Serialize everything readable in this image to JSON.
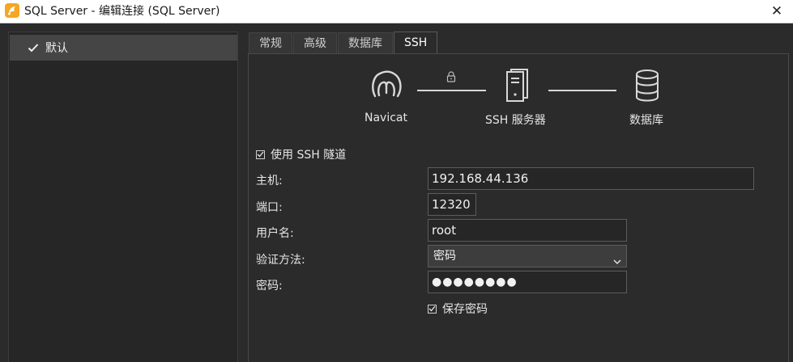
{
  "window": {
    "title": "SQL Server - 编辑连接 (SQL Server)",
    "close_symbol": "✕"
  },
  "sidebar": {
    "items": [
      {
        "label": "默认",
        "selected": true
      }
    ]
  },
  "tabs": [
    {
      "label": "常规",
      "active": false
    },
    {
      "label": "高级",
      "active": false
    },
    {
      "label": "数据库",
      "active": false
    },
    {
      "label": "SSH",
      "active": true
    }
  ],
  "diagram": {
    "nodes": [
      {
        "label": "Navicat",
        "icon": "navicat-logo-icon"
      },
      {
        "label": "SSH 服务器",
        "icon": "server-icon"
      },
      {
        "label": "数据库",
        "icon": "database-icon"
      }
    ],
    "link_icon": "lock-icon"
  },
  "form": {
    "use_ssh_tunnel": {
      "label": "使用 SSH 隧道",
      "checked": true
    },
    "host": {
      "label": "主机:",
      "value": "192.168.44.136"
    },
    "port": {
      "label": "端口:",
      "value": "12320"
    },
    "username": {
      "label": "用户名:",
      "value": "root"
    },
    "auth_method": {
      "label": "验证方法:",
      "value": "密码"
    },
    "password": {
      "label": "密码:",
      "value": "●●●●●●●●"
    },
    "save_password": {
      "label": "保存密码",
      "checked": true
    }
  },
  "colors": {
    "background": "#2b2b2b",
    "sidebar_selected": "#454545",
    "titlebar": "#ffffff",
    "app_icon": "#f5a623"
  }
}
